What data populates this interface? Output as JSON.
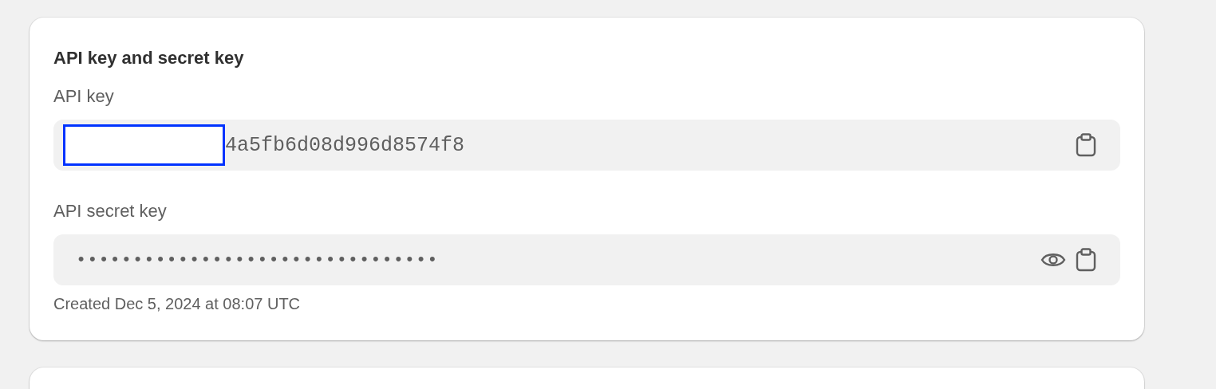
{
  "card": {
    "title": "API key and secret key",
    "fields": [
      {
        "label": "API key",
        "value": "4a5fb6d08d996d8574f8",
        "redacted": true,
        "masked": false
      },
      {
        "label": "API secret key",
        "value": "••••••••••••••••••••••••••••••••",
        "redacted": false,
        "masked": true
      }
    ],
    "footnote": "Created Dec 5, 2024 at 08:07 UTC"
  }
}
